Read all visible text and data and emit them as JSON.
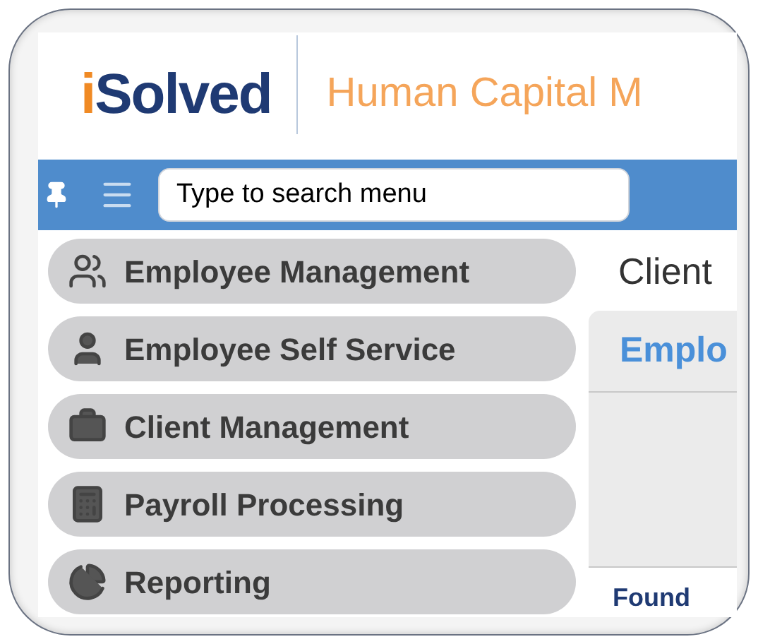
{
  "header": {
    "logo": "iSolved",
    "title": "Human Capital M"
  },
  "toolbar": {
    "search": {
      "placeholder": "Type to search menu"
    }
  },
  "sidebar": {
    "items": [
      {
        "label": "Employee Management",
        "kind": "people"
      },
      {
        "label": "Employee Self Service",
        "kind": "person"
      },
      {
        "label": "Client Management",
        "kind": "briefcase"
      },
      {
        "label": "Payroll Processing",
        "kind": "calculator"
      },
      {
        "label": "Reporting",
        "kind": "report"
      }
    ]
  },
  "main": {
    "heading": "Client",
    "tab": "Emplo",
    "footer": "Found"
  }
}
